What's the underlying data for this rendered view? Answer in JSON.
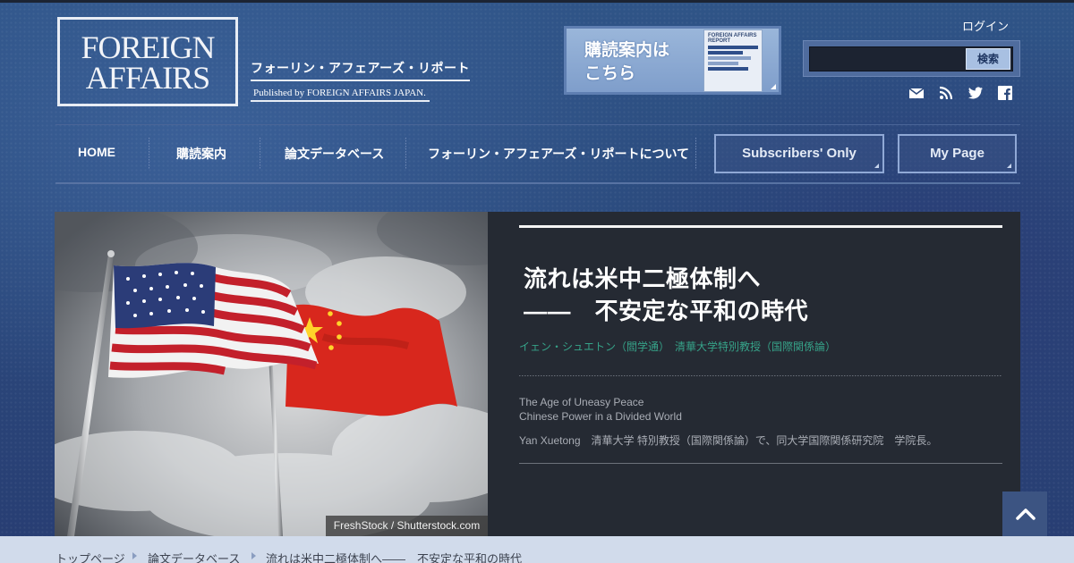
{
  "header": {
    "logo_line1": "FOREIGN",
    "logo_line2": "AFFAIRS",
    "jp_name": "フォーリン・アフェアーズ・リポート",
    "published": "Published by FOREIGN AFFAIRS JAPAN.",
    "ad_line1": "購読案内は",
    "ad_line2": "こちら",
    "ad_cover_title": "FOREIGN AFFAIRS REPORT",
    "login": "ログイン",
    "search_placeholder": "",
    "search_button": "検索",
    "social_icons": [
      "mail-icon",
      "rss-icon",
      "twitter-icon",
      "facebook-icon"
    ]
  },
  "nav": {
    "items": [
      "HOME",
      "購読案内",
      "論文データベース",
      "フォーリン・アフェアーズ・リポートについて"
    ],
    "subscribers": "Subscribers' Only",
    "mypage": "My Page"
  },
  "hero": {
    "image_alt": "US and Chinese flags on flagpoles against a cloudy sky",
    "credit": "FreshStock / Shutterstock.com",
    "title_line1": "流れは米中二極体制へ",
    "title_line2": "——　不安定な平和の時代",
    "author_jp": "イェン・シュエトン（閻学通）　清華大学特別教授（国際関係論）",
    "en_title_line1": "The Age of Uneasy Peace",
    "en_title_line2": "Chinese Power in a Divided World",
    "en_author": "Yan Xuetong　清華大学 特別教授（国際関係論）で、同大学国際関係研究院　学院長。"
  },
  "breadcrumb": [
    "トップページ",
    "論文データベース",
    "流れは米中二極体制へ——　不安定な平和の時代"
  ],
  "colors": {
    "background": "#2d4a7c",
    "panel": "#252a33",
    "author_green": "#36a389",
    "breadcrumb_bg": "#d1dbeb"
  }
}
